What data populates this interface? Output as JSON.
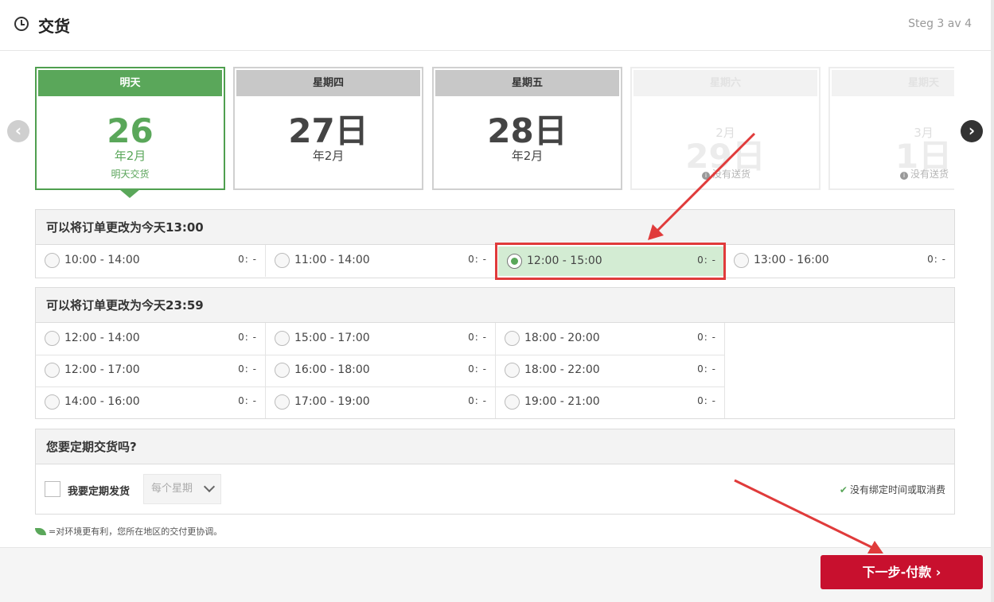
{
  "header": {
    "title": "交货",
    "step": "Steg 3 av 4"
  },
  "days": [
    {
      "name": "明天",
      "number": "26",
      "month": "年2月",
      "note": "明天交货",
      "state": "active"
    },
    {
      "name": "星期四",
      "number": "27日",
      "month": "年2月",
      "note": "",
      "state": "normal"
    },
    {
      "name": "星期五",
      "number": "28日",
      "month": "年2月",
      "note": "",
      "state": "normal"
    },
    {
      "name": "星期六",
      "number": "29日",
      "month": "2月",
      "note": "没有送货",
      "state": "disabled"
    },
    {
      "name": "星期天",
      "number": "1日",
      "month": "3月",
      "note": "没有送货",
      "state": "disabled"
    }
  ],
  "section1": {
    "title": "可以将订单更改为今天13:00",
    "slots": [
      {
        "time": "10:00 - 14:00",
        "price": "0: -",
        "selected": false
      },
      {
        "time": "11:00 - 14:00",
        "price": "0: -",
        "selected": false
      },
      {
        "time": "12:00 - 15:00",
        "price": "0: -",
        "selected": true
      },
      {
        "time": "13:00 - 16:00",
        "price": "0: -",
        "selected": false
      }
    ]
  },
  "section2": {
    "title": "可以将订单更改为今天23:59",
    "slots": [
      {
        "time": "12:00 - 14:00",
        "price": "0: -"
      },
      {
        "time": "15:00 - 17:00",
        "price": "0: -"
      },
      {
        "time": "18:00 - 20:00",
        "price": "0: -"
      },
      {
        "time": "12:00 - 17:00",
        "price": "0: -"
      },
      {
        "time": "16:00 - 18:00",
        "price": "0: -"
      },
      {
        "time": "18:00 - 22:00",
        "price": "0: -"
      },
      {
        "time": "14:00 - 16:00",
        "price": "0: -"
      },
      {
        "time": "17:00 - 19:00",
        "price": "0: -"
      },
      {
        "time": "19:00 - 21:00",
        "price": "0: -"
      }
    ]
  },
  "recurring": {
    "title": "您要定期交货吗?",
    "checkbox_label": "我要定期发货",
    "select_value": "每个星期",
    "note": "没有绑定时间或取消费"
  },
  "eco_note": "=对环境更有利，您所在地区的交付更协调。",
  "footer": {
    "next_button": "下一步-付款 ›"
  },
  "icons": {
    "prev": "chevron-left-icon",
    "next": "chevron-right-icon",
    "clock": "clock-icon",
    "leaf": "leaf-icon"
  },
  "colors": {
    "accent_green": "#5aa75a",
    "button_red": "#c8102e",
    "annotation_red": "#e03b3b"
  }
}
